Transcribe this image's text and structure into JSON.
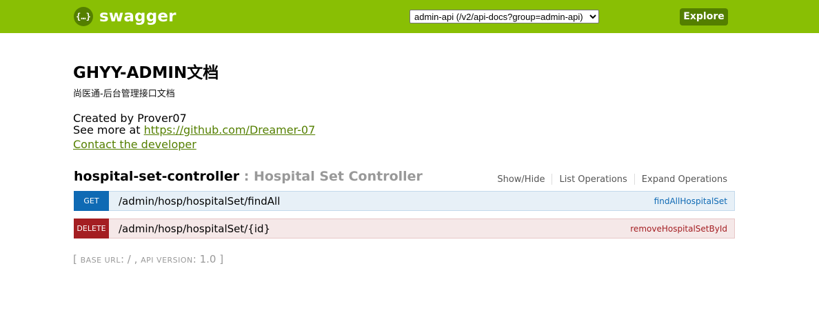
{
  "header": {
    "logo_glyph": "{…}",
    "logo_text": "swagger",
    "api_select_value": "admin-api (/v2/api-docs?group=admin-api)",
    "explore_label": "Explore",
    "colors": {
      "header_bg": "#89bf04",
      "explore_bg": "#547f00"
    }
  },
  "info": {
    "title": "GHYY-ADMIN文档",
    "description": "尚医通-后台管理接口文档",
    "created_by": "Created by Prover07",
    "see_more_prefix": "See more at ",
    "see_more_link": "https://github.com/Dreamer-07",
    "contact_label": "Contact the developer"
  },
  "resource": {
    "name": "hospital-set-controller",
    "separator": " : ",
    "description": "Hospital Set Controller",
    "operations": [
      "Show/Hide",
      "List Operations",
      "Expand Operations"
    ]
  },
  "endpoints": [
    {
      "method": "GET",
      "path": "/admin/hosp/hospitalSet/findAll",
      "nickname": "findAllHospitalSet",
      "color": "#0f6ab4"
    },
    {
      "method": "DELETE",
      "path": "/admin/hosp/hospitalSet/{id}",
      "nickname": "removeHospitalSetById",
      "color": "#a41e22"
    }
  ],
  "footer": {
    "open_bracket": "[ ",
    "base_url_label": "base url",
    "base_url_value": ": / , ",
    "api_version_label": "api version",
    "api_version_value": ": 1.0 ",
    "close_bracket": "]"
  }
}
